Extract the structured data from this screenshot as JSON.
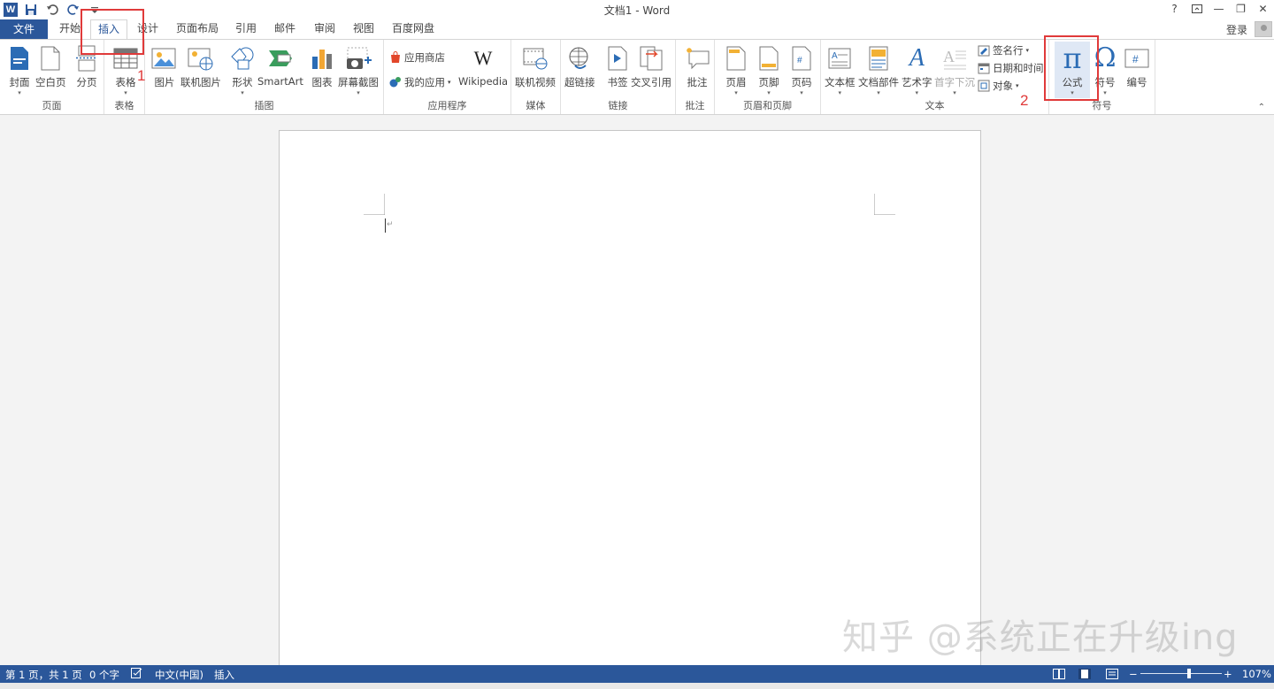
{
  "window": {
    "title": "文档1 - Word",
    "help_label": "?",
    "minimize_label": "—",
    "maximize_label": "❐",
    "close_label": "✕",
    "word_logo_label": "W"
  },
  "quick_access": {
    "icons": [
      "save-icon",
      "undo-icon",
      "redo-icon",
      "customize-icon"
    ]
  },
  "tabs": [
    {
      "label": "文件"
    },
    {
      "label": "开始"
    },
    {
      "label": "插入"
    },
    {
      "label": "设计"
    },
    {
      "label": "页面布局"
    },
    {
      "label": "引用"
    },
    {
      "label": "邮件"
    },
    {
      "label": "审阅"
    },
    {
      "label": "视图"
    },
    {
      "label": "百度网盘"
    }
  ],
  "account": {
    "signin_label": "登录"
  },
  "ribbon": {
    "groups": {
      "pages": "页面",
      "tables": "表格",
      "illustrations": "插图",
      "apps": "应用程序",
      "media": "媒体",
      "links": "链接",
      "comments": "批注",
      "header_footer": "页眉和页脚",
      "text": "文本",
      "symbols": "符号"
    },
    "buttons": {
      "cover": "封面",
      "blank_page": "空白页",
      "page_break": "分页",
      "table": "表格",
      "picture": "图片",
      "online_picture": "联机图片",
      "shapes": "形状",
      "smartart": "SmartArt",
      "chart": "图表",
      "screenshot": "屏幕截图",
      "store": "应用商店",
      "my_apps": "我的应用",
      "wikipedia": "Wikipedia",
      "online_video": "联机视频",
      "hyperlink": "超链接",
      "bookmark": "书签",
      "cross_ref": "交叉引用",
      "comment": "批注",
      "header": "页眉",
      "footer": "页脚",
      "page_number": "页码",
      "textbox": "文本框",
      "quick_parts": "文档部件",
      "wordart": "艺术字",
      "drop_cap": "首字下沉",
      "signature": "签名行",
      "datetime": "日期和时间",
      "object": "对象",
      "equation": "公式",
      "symbol": "符号",
      "numbering": "编号"
    },
    "dropdown_glyph": "▾",
    "collapse_glyph": "⌃"
  },
  "annotations": {
    "step1": "1",
    "step2": "2",
    "highlight_color": "#e03a3a"
  },
  "document": {
    "paragraph_mark": "↵"
  },
  "watermark": "知乎 @系统正在升级ing",
  "status": {
    "page": "第 1 页，共 1 页",
    "words": "0 个字",
    "language": "中文(中国)",
    "mode": "插入",
    "zoom": "107%",
    "zoom_minus": "−",
    "zoom_plus": "+",
    "zoom_fraction": 0.6
  },
  "colors": {
    "accent": "#2b579a",
    "pi_blue": "#2b6cb5"
  }
}
